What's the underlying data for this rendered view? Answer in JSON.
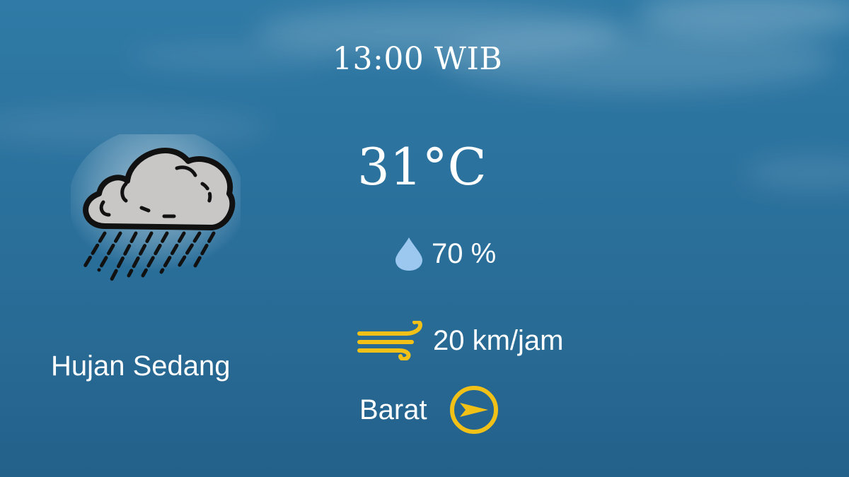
{
  "forecast": {
    "time": "13:00 WIB",
    "temperature": "31°C",
    "condition": "Hujan Sedang",
    "humidity": "70 %",
    "wind_speed": "20 km/jam",
    "wind_direction": "Barat"
  },
  "icons": {
    "weather": "rain-cloud-icon",
    "humidity": "water-drop-icon",
    "wind": "wind-icon",
    "direction": "compass-arrow-icon"
  },
  "colors": {
    "text": "#ffffff",
    "accent_yellow": "#f2c118",
    "drop_blue": "#9cc8f0",
    "cloud_gray": "#c9c6c6",
    "cloud_outline": "#111111"
  }
}
